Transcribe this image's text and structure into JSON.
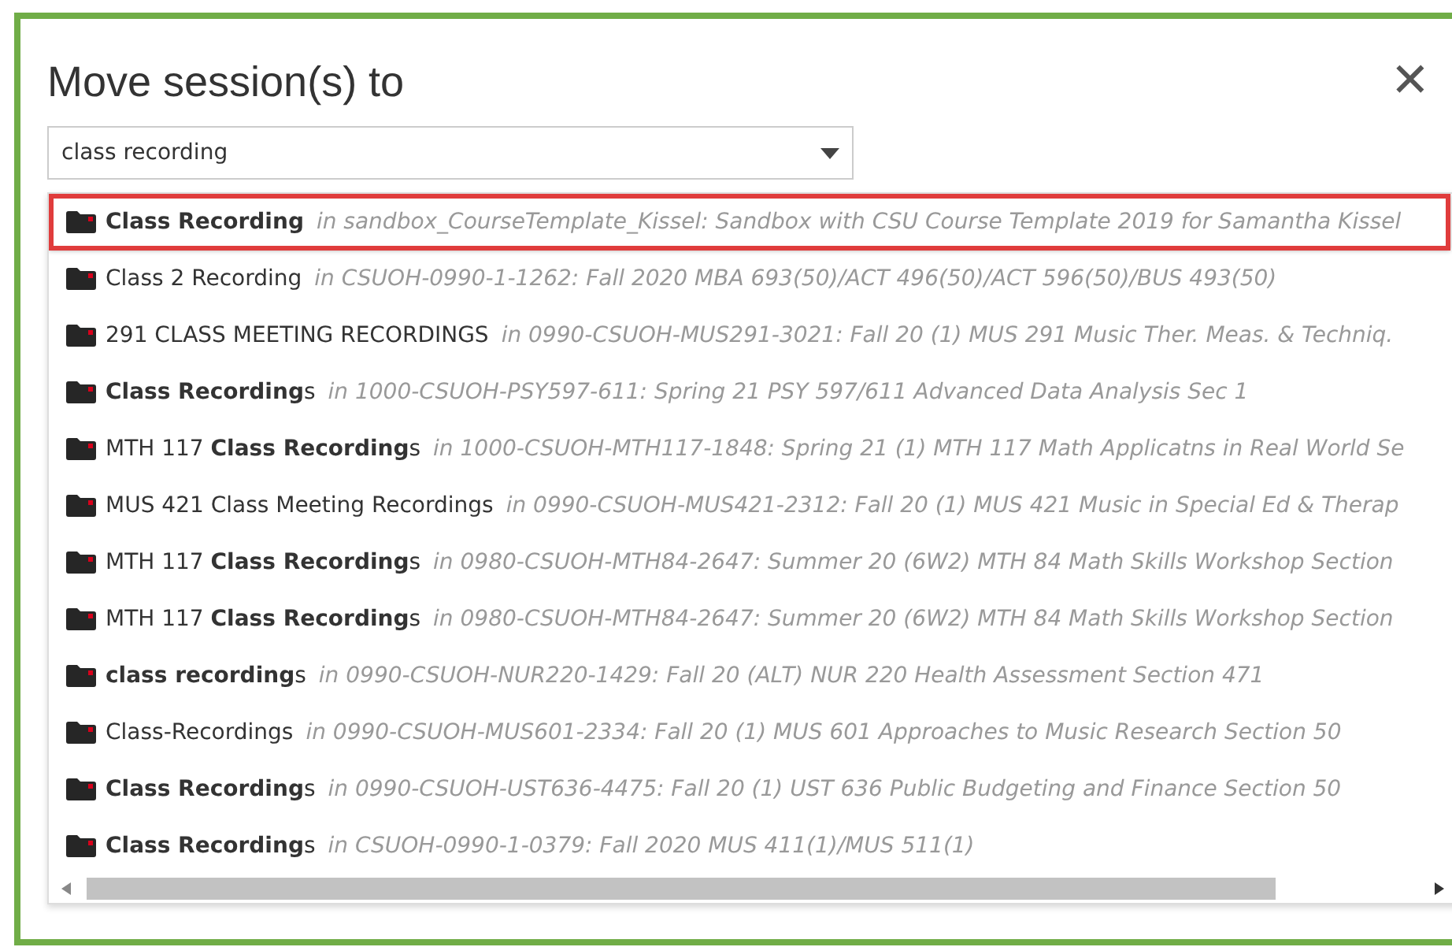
{
  "dialog": {
    "title": "Move session(s) to",
    "close": "✕"
  },
  "search": {
    "value": "class recording"
  },
  "results": [
    {
      "name": "**Class Recording**",
      "context": "in sandbox_CourseTemplate_Kissel: Sandbox with CSU Course Template 2019 for Samantha Kissel",
      "highlighted": true
    },
    {
      "name": "Class 2 Recording",
      "context": "in CSUOH-0990-1-1262: Fall 2020 MBA 693(50)/ACT 496(50)/ACT 596(50)/BUS 493(50)",
      "highlighted": false
    },
    {
      "name": "291 CLASS MEETING RECORDINGS",
      "context": "in 0990-CSUOH-MUS291-3021: Fall 20 (1) MUS 291 Music Ther. Meas. & Techniq.",
      "highlighted": false
    },
    {
      "name": "**Class Recording**s",
      "context": "in 1000-CSUOH-PSY597-611: Spring 21 PSY 597/611 Advanced Data Analysis Sec 1",
      "highlighted": false
    },
    {
      "name": "MTH 117 **Class Recording**s",
      "context": "in 1000-CSUOH-MTH117-1848: Spring 21 (1) MTH 117 Math Applicatns in Real World Se",
      "highlighted": false
    },
    {
      "name": "MUS 421 Class Meeting Recordings",
      "context": "in 0990-CSUOH-MUS421-2312: Fall 20 (1) MUS 421 Music in Special Ed & Therap",
      "highlighted": false
    },
    {
      "name": "MTH 117 **Class Recording**s",
      "context": "in 0980-CSUOH-MTH84-2647: Summer 20 (6W2) MTH 84 Math Skills Workshop Section",
      "highlighted": false
    },
    {
      "name": "MTH 117 **Class Recording**s",
      "context": "in 0980-CSUOH-MTH84-2647: Summer 20 (6W2) MTH 84 Math Skills Workshop Section",
      "highlighted": false
    },
    {
      "name": "**class recording**s",
      "context": "in 0990-CSUOH-NUR220-1429: Fall 20 (ALT) NUR 220 Health Assessment Section 471",
      "highlighted": false
    },
    {
      "name": "Class-Recordings",
      "context": "in 0990-CSUOH-MUS601-2334: Fall 20 (1) MUS 601 Approaches to Music Research Section 50",
      "highlighted": false
    },
    {
      "name": "**Class Recording**s",
      "context": "in 0990-CSUOH-UST636-4475: Fall 20 (1) UST 636 Public Budgeting and Finance Section 50",
      "highlighted": false
    },
    {
      "name": "**Class Recording**s",
      "context": "in CSUOH-0990-1-0379: Fall 2020 MUS 411(1)/MUS 511(1)",
      "highlighted": false
    }
  ]
}
